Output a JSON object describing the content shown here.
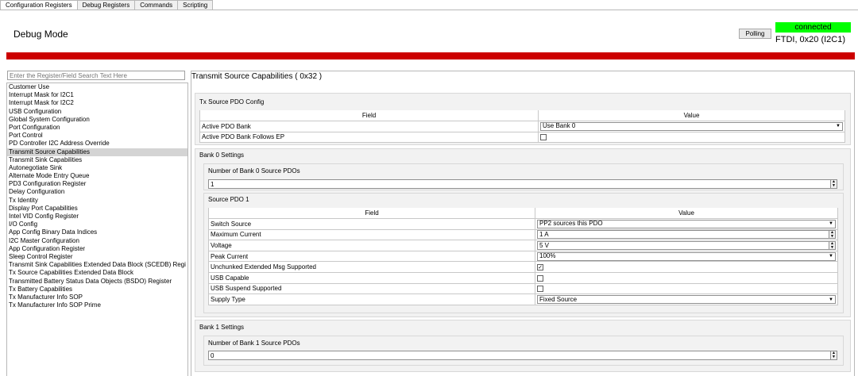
{
  "tabs": [
    "Configuration Registers",
    "Debug Registers",
    "Commands",
    "Scripting"
  ],
  "header": {
    "mode_title": "Debug Mode",
    "polling_label": "Polling",
    "connection_status": "connected",
    "connection_desc": "FTDI, 0x20 (I2C1)",
    "status_color": "#00ff00",
    "accent_bar_color": "#cc0000"
  },
  "search": {
    "placeholder": "Enter the Register/Field Search Text Here"
  },
  "registers": [
    "Customer Use",
    "Interrupt Mask for I2C1",
    "Interrupt Mask for I2C2",
    "USB Configuration",
    "Global System Configuration",
    "Port Configuration",
    "Port Control",
    "PD Controller I2C Address Override",
    "Transmit Source Capabilities",
    "Transmit Sink Capabilities",
    "Autonegotiate Sink",
    "Alternate Mode Entry Queue",
    "PD3 Configuration Register",
    "Delay Configuration",
    "Tx Identity",
    "Display Port Capabilities",
    "Intel VID Config Register",
    "I/O Config",
    "App Config Binary Data Indices",
    "I2C Master Configuration",
    "App Configuration Register",
    "Sleep Control Register",
    "Transmit Sink Capabilities Extended Data Block (SCEDB) Regi",
    "Tx Source Capabilities Extended Data Block",
    "Transmitted Battery Status Data Objects (BSDO) Register",
    "Tx Battery Capabilities",
    "Tx Manufacturer Info SOP",
    "Tx Manufacturer Info SOP Prime"
  ],
  "selected_register": "Transmit Source Capabilities",
  "detail": {
    "title": "Transmit Source Capabilities  ( 0x32 )",
    "tx_config": {
      "label": "Tx Source PDO Config",
      "col_field": "Field",
      "col_value": "Value",
      "active_pdo_bank_label": "Active PDO Bank",
      "active_pdo_bank_value": "Use Bank 0",
      "follows_ep_label": "Active PDO Bank Follows EP"
    },
    "bank0": {
      "label": "Bank 0 Settings",
      "num_pdos_label": "Number of Bank 0 Source PDOs",
      "num_pdos_value": "1",
      "pdo1": {
        "label": "Source PDO 1",
        "col_field": "Field",
        "col_value": "Value",
        "switch_source_label": "Switch Source",
        "switch_source_value": "PP2 sources this PDO",
        "max_current_label": "Maximum Current",
        "max_current_value": "1 A",
        "voltage_label": "Voltage",
        "voltage_value": "5 V",
        "peak_current_label": "Peak Current",
        "peak_current_value": "100%",
        "unchunked_label": "Unchunked Extended Msg Supported",
        "usb_capable_label": "USB Capable",
        "usb_suspend_label": "USB Suspend Supported",
        "supply_type_label": "Supply Type",
        "supply_type_value": "Fixed Source"
      }
    },
    "bank1": {
      "label": "Bank 1 Settings",
      "num_pdos_label": "Number of Bank 1 Source PDOs",
      "num_pdos_value": "0"
    }
  }
}
